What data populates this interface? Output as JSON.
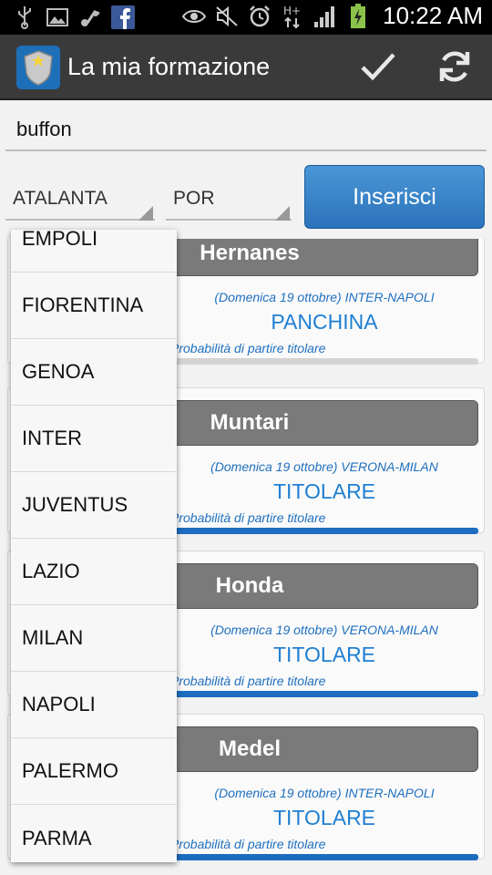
{
  "status_bar": {
    "time": "10:22 AM",
    "notification_icons": [
      "usb-icon",
      "image-icon",
      "music-icon",
      "facebook-icon"
    ],
    "system_icons": [
      "eye-icon",
      "mute-icon",
      "alarm-icon",
      "hplus-signal-icon",
      "signal-bars-icon",
      "battery-charging-icon"
    ]
  },
  "action_bar": {
    "title": "La mia formazione",
    "confirm_icon": "check-icon",
    "refresh_icon": "refresh-icon"
  },
  "search": {
    "value": "buffon"
  },
  "filters": {
    "team_selected": "ATALANTA",
    "role_selected": "POR",
    "insert_label": "Inserisci"
  },
  "dropdown": {
    "items": [
      "EMPOLI",
      "FIORENTINA",
      "GENOA",
      "INTER",
      "JUVENTUS",
      "LAZIO",
      "MILAN",
      "NAPOLI",
      "PALERMO",
      "PARMA"
    ]
  },
  "players": [
    {
      "name": "Hernanes",
      "match": "(Domenica 19 ottobre) INTER-NAPOLI",
      "status": "PANCHINA",
      "prob_label": "Probabilità di partire titolare",
      "prob": 0.0
    },
    {
      "name": "Muntari",
      "match": "(Domenica 19 ottobre) VERONA-MILAN",
      "status": "TITOLARE",
      "prob_label": "Probabilità di partire titolare",
      "prob": 1.0
    },
    {
      "name": "Honda",
      "match": "(Domenica 19 ottobre) VERONA-MILAN",
      "status": "TITOLARE",
      "prob_label": "Probabilità di partire titolare",
      "prob": 1.0
    },
    {
      "name": "Medel",
      "match": "(Domenica 19 ottobre) INTER-NAPOLI",
      "status": "TITOLARE",
      "prob_label": "Probabilità di partire titolare",
      "prob": 1.0
    }
  ],
  "colors": {
    "action_bar": "#3a3a3a",
    "accent_blue": "#1f7fd2",
    "button_blue": "#2b73bb",
    "name_header": "#7a7a7a"
  }
}
